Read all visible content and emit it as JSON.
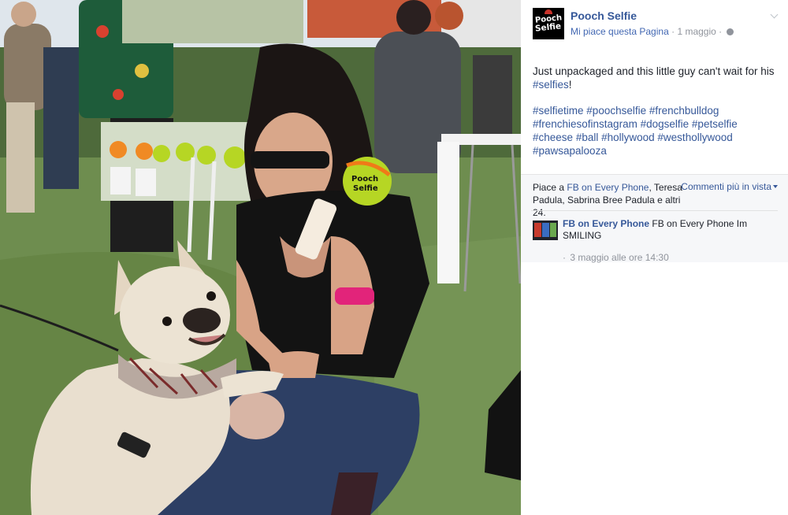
{
  "post": {
    "page_name": "Pooch Selfie",
    "like_page": "Mi piace questa Pagina",
    "meta_sep": "·",
    "date": "1 maggio",
    "meta_sep2": "·",
    "logo_line1": "Pooch",
    "logo_line2": "Selfie",
    "text_line": "Just unpackaged and this little guy can't wait for his",
    "hashtag_in_text": "#selfies",
    "text_end": "!",
    "hashtags": [
      "#selfietime",
      "#poochselfie",
      "#frenchbulldog",
      "#frenchiesofinstagram",
      "#dogselfie",
      "#petselfie",
      "#cheese",
      "#ball",
      "#hollywood",
      "#westhollywood",
      "#pawsapalooza"
    ]
  },
  "feedback": {
    "likes_prefix": "Piace a",
    "liker_1": "FB on Every Phone",
    "likes_rest": ", Teresa Padula, Sabrina Bree Padula e altri 24.",
    "sort_label": "Commenti più in vista"
  },
  "comment": {
    "author": "FB on Every Phone",
    "text": "FB on Every Phone Im SMILING",
    "time_dot": "·",
    "time": "3 maggio alle ore 14:30"
  },
  "photo": {
    "ball_text_1": "Pooch",
    "ball_text_2": "Selfie"
  },
  "colors": {
    "link": "#365899",
    "meta": "#90949c",
    "feedback_bg": "#f6f7f9",
    "ball": "#b6d624",
    "ball_accent": "#f07a18"
  }
}
